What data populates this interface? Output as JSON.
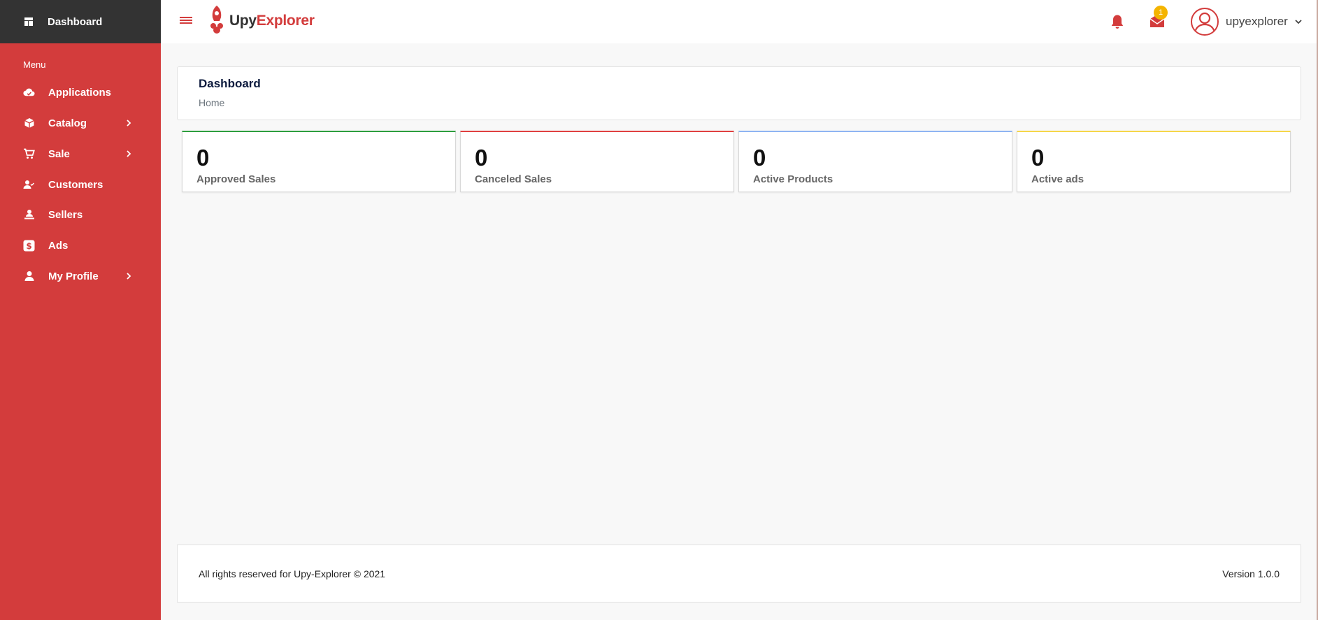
{
  "colors": {
    "brand_red": "#d33c3c",
    "sidebar_top": "#333333",
    "approved_border": "#2e9e3e",
    "canceled_border": "#e04040",
    "products_border": "#8fb4f2",
    "ads_border": "#f6d64a",
    "badge": "#f4b400"
  },
  "sidebar": {
    "top_label": "Dashboard",
    "top_icon": "dashboard-icon",
    "menu_heading": "Menu",
    "items": [
      {
        "label": "Applications",
        "icon": "cloud-icon",
        "has_submenu": false
      },
      {
        "label": "Catalog",
        "icon": "box-icon",
        "has_submenu": true
      },
      {
        "label": "Sale",
        "icon": "cart-icon",
        "has_submenu": true
      },
      {
        "label": "Customers",
        "icon": "user-check-icon",
        "has_submenu": false
      },
      {
        "label": "Sellers",
        "icon": "seller-icon",
        "has_submenu": false
      },
      {
        "label": "Ads",
        "icon": "dollar-icon",
        "has_submenu": false
      },
      {
        "label": "My Profile",
        "icon": "user-icon",
        "has_submenu": true
      }
    ]
  },
  "header": {
    "logo_upy": "Upy",
    "logo_explorer": "Explorer",
    "mail_badge": "1",
    "username": "upyexplorer"
  },
  "page": {
    "title": "Dashboard",
    "breadcrumb": "Home"
  },
  "stats": [
    {
      "value": "0",
      "label": "Approved Sales"
    },
    {
      "value": "0",
      "label": "Canceled Sales"
    },
    {
      "value": "0",
      "label": "Active Products"
    },
    {
      "value": "0",
      "label": "Active ads"
    }
  ],
  "footer": {
    "copyright": "All rights reserved for Upy-Explorer © 2021",
    "version": "Version 1.0.0"
  }
}
